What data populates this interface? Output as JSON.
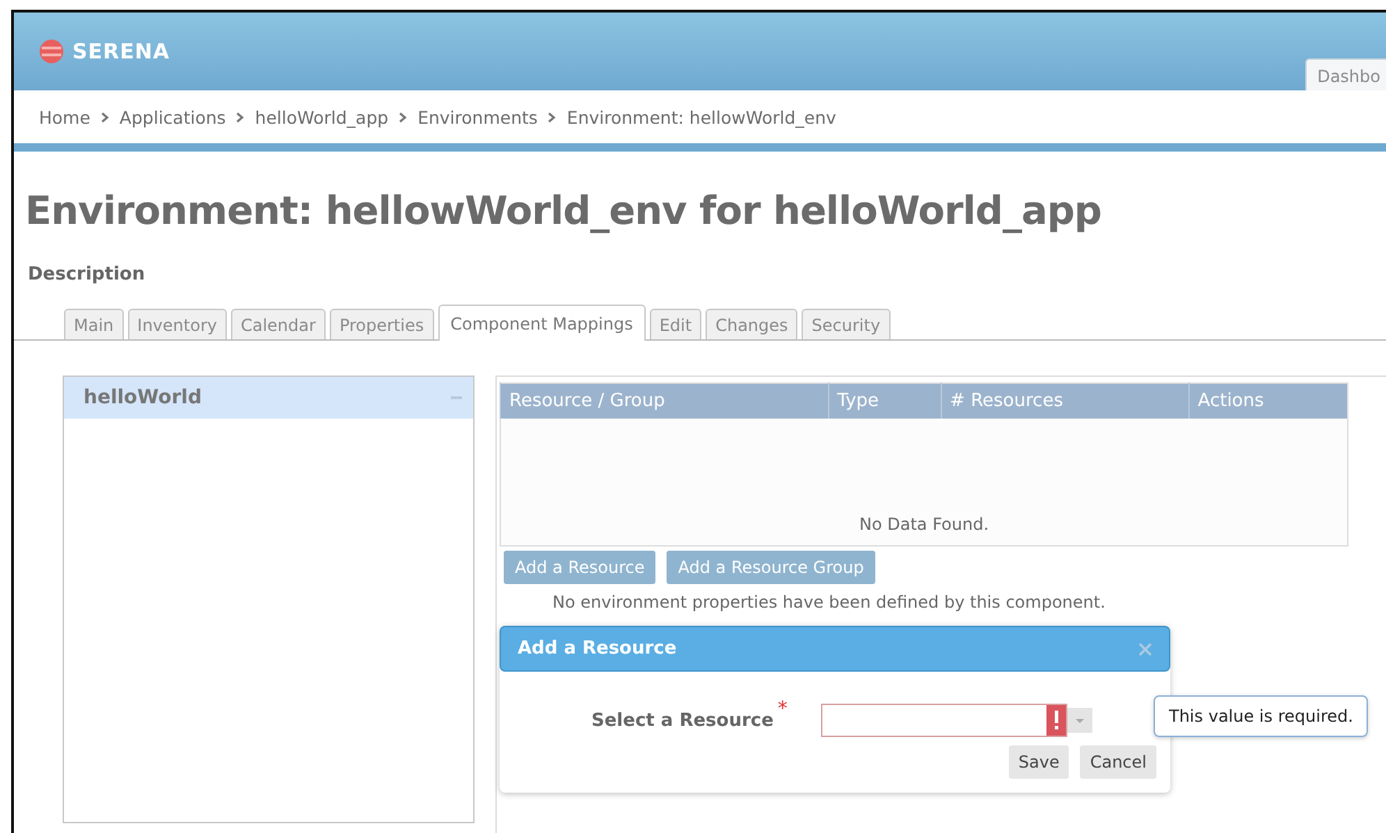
{
  "header": {
    "logo": "SERENA",
    "tab": "Dashbo"
  },
  "breadcrumb": [
    {
      "label": "Home"
    },
    {
      "label": "Applications"
    },
    {
      "label": "helloWorld_app"
    },
    {
      "label": "Environments"
    },
    {
      "label": "Environment: hellowWorld_env"
    }
  ],
  "title": "Environment: hellowWorld_env for helloWorld_app",
  "description_label": "Description",
  "tabs": [
    {
      "label": "Main",
      "selected": false
    },
    {
      "label": "Inventory",
      "selected": false
    },
    {
      "label": "Calendar",
      "selected": false
    },
    {
      "label": "Properties",
      "selected": false
    },
    {
      "label": "Component Mappings",
      "selected": true
    },
    {
      "label": "Edit",
      "selected": false
    },
    {
      "label": "Changes",
      "selected": false
    },
    {
      "label": "Security",
      "selected": false
    }
  ],
  "components": [
    {
      "label": "helloWorld",
      "selected": true
    }
  ],
  "table": {
    "columns": [
      "Resource / Group",
      "Type",
      "# Resources",
      "Actions"
    ],
    "empty_message": "No Data Found."
  },
  "buttons": [
    "Add a Resource",
    "Add a Resource Group"
  ],
  "note": "No environment properties have been defined by this component.",
  "dialog": {
    "title": "Add a Resource",
    "field": {
      "label": "Select a Resource",
      "required_mark": "*",
      "invalid": true,
      "error": "This value is required."
    },
    "buttons": [
      "Save",
      "Cancel"
    ]
  }
}
